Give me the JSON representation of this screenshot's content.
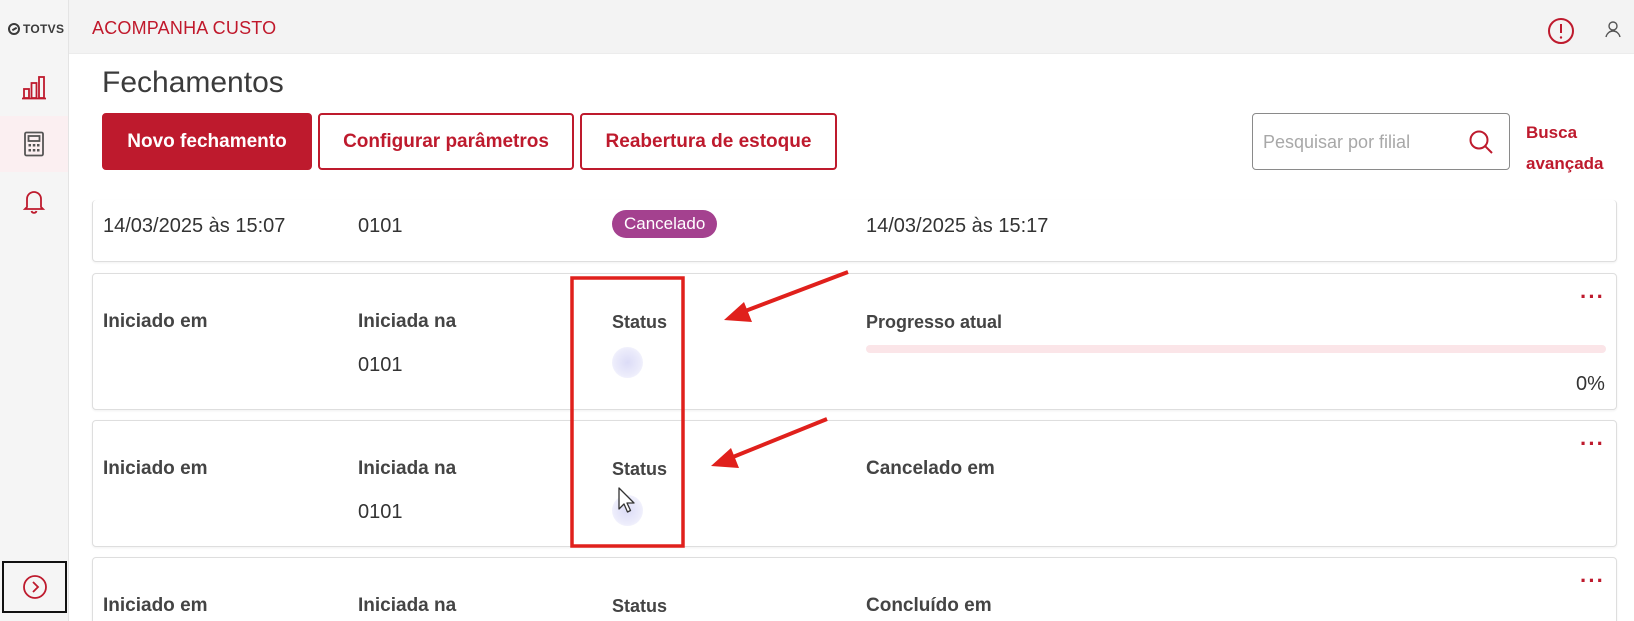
{
  "sidebar": {
    "logo_text": "TOTVS",
    "items": [
      {
        "icon": "bar-chart-icon"
      },
      {
        "icon": "calculator-icon",
        "active": true
      },
      {
        "icon": "bell-icon"
      }
    ],
    "expand_icon": "chevron-right-circle-icon"
  },
  "topbar": {
    "app_title": "ACOMPANHA CUSTO",
    "alert_icon": "alert-circle-icon",
    "user_icon": "user-icon"
  },
  "page": {
    "title": "Fechamentos",
    "buttons": {
      "new": "Novo fechamento",
      "config": "Configurar parâmetros",
      "reopen": "Reabertura de estoque"
    },
    "search": {
      "placeholder": "Pesquisar por filial",
      "advanced_line1": "Busca",
      "advanced_line2": "avançada"
    }
  },
  "cards": [
    {
      "started_value": "14/03/2025 às 15:07",
      "branch_value": "0101",
      "status_badge": "Cancelado",
      "end_value": "14/03/2025 às 15:17"
    },
    {
      "started_label": "Iniciado em",
      "branch_label": "Iniciada na",
      "branch_value": "0101",
      "status_label": "Status",
      "progress_label": "Progresso atual",
      "progress_value": 0,
      "progress_text": "0%",
      "menu": "···"
    },
    {
      "started_label": "Iniciado em",
      "branch_label": "Iniciada na",
      "branch_value": "0101",
      "status_label": "Status",
      "end_label": "Cancelado em",
      "menu": "···"
    },
    {
      "started_label": "Iniciado em",
      "branch_label": "Iniciada na",
      "status_label": "Status",
      "end_label": "Concluído em",
      "menu": "···"
    }
  ],
  "colors": {
    "brand": "#be1a2d",
    "badge_cancelled": "#a4418f",
    "annotation": "#e0201c"
  }
}
